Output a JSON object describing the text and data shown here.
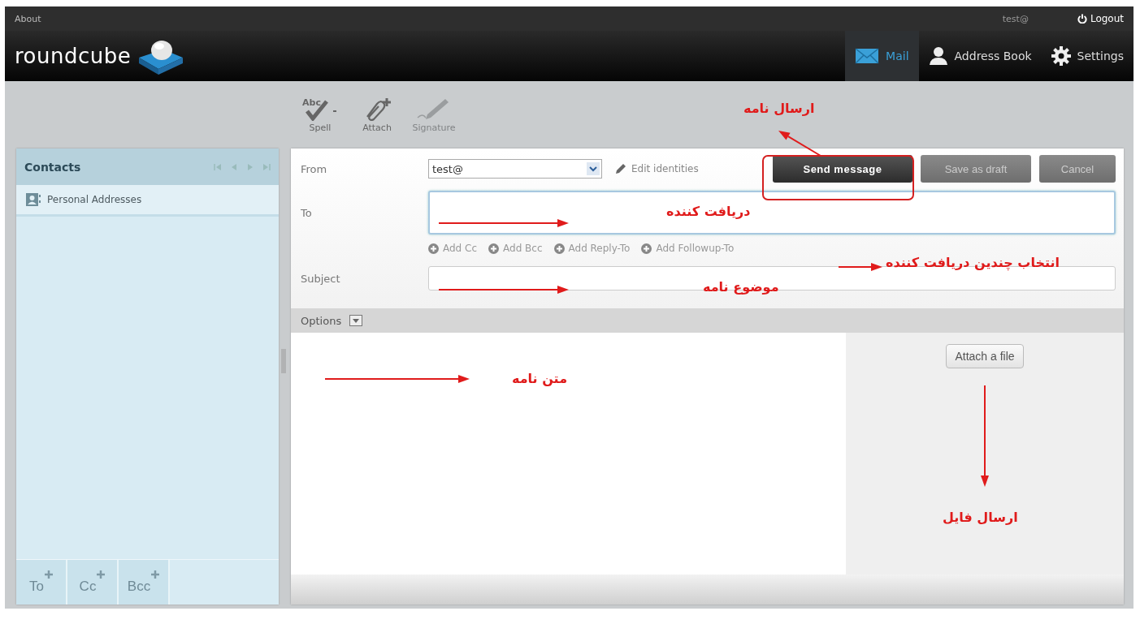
{
  "top_bar": {
    "about": "About",
    "user": "test@",
    "logout": "Logout"
  },
  "header": {
    "logo": "roundcube",
    "nav": [
      {
        "label": "Mail",
        "selected": true
      },
      {
        "label": "Address Book",
        "selected": false
      },
      {
        "label": "Settings",
        "selected": false
      }
    ]
  },
  "toolbar": [
    {
      "label": "Spell",
      "icon_caption": "Abc",
      "disabled": false
    },
    {
      "label": "Attach",
      "disabled": false
    },
    {
      "label": "Signature",
      "disabled": true
    }
  ],
  "contacts": {
    "title": "Contacts",
    "items": [
      {
        "label": "Personal Addresses"
      }
    ],
    "footer_buttons": [
      "To",
      "Cc",
      "Bcc"
    ]
  },
  "compose": {
    "from_label": "From",
    "from_value": "test@",
    "edit_identities": "Edit identities",
    "buttons": [
      {
        "label": "Send message",
        "kind": "primary"
      },
      {
        "label": "Save as draft",
        "kind": "secondary"
      },
      {
        "label": "Cancel",
        "kind": "secondary"
      }
    ],
    "to_label": "To",
    "add_links": [
      "Add Cc",
      "Add Bcc",
      "Add Reply-To",
      "Add Followup-To"
    ],
    "subject_label": "Subject",
    "options_label": "Options",
    "attach_button": "Attach a file"
  },
  "annotations": [
    {
      "text": "ارسال نامه"
    },
    {
      "text": "دریافت کننده"
    },
    {
      "text": "انتخاب چندین  دریافت کننده"
    },
    {
      "text": "موضوع نامه"
    },
    {
      "text": "متن نامه"
    },
    {
      "text": "ارسال فایل"
    }
  ]
}
